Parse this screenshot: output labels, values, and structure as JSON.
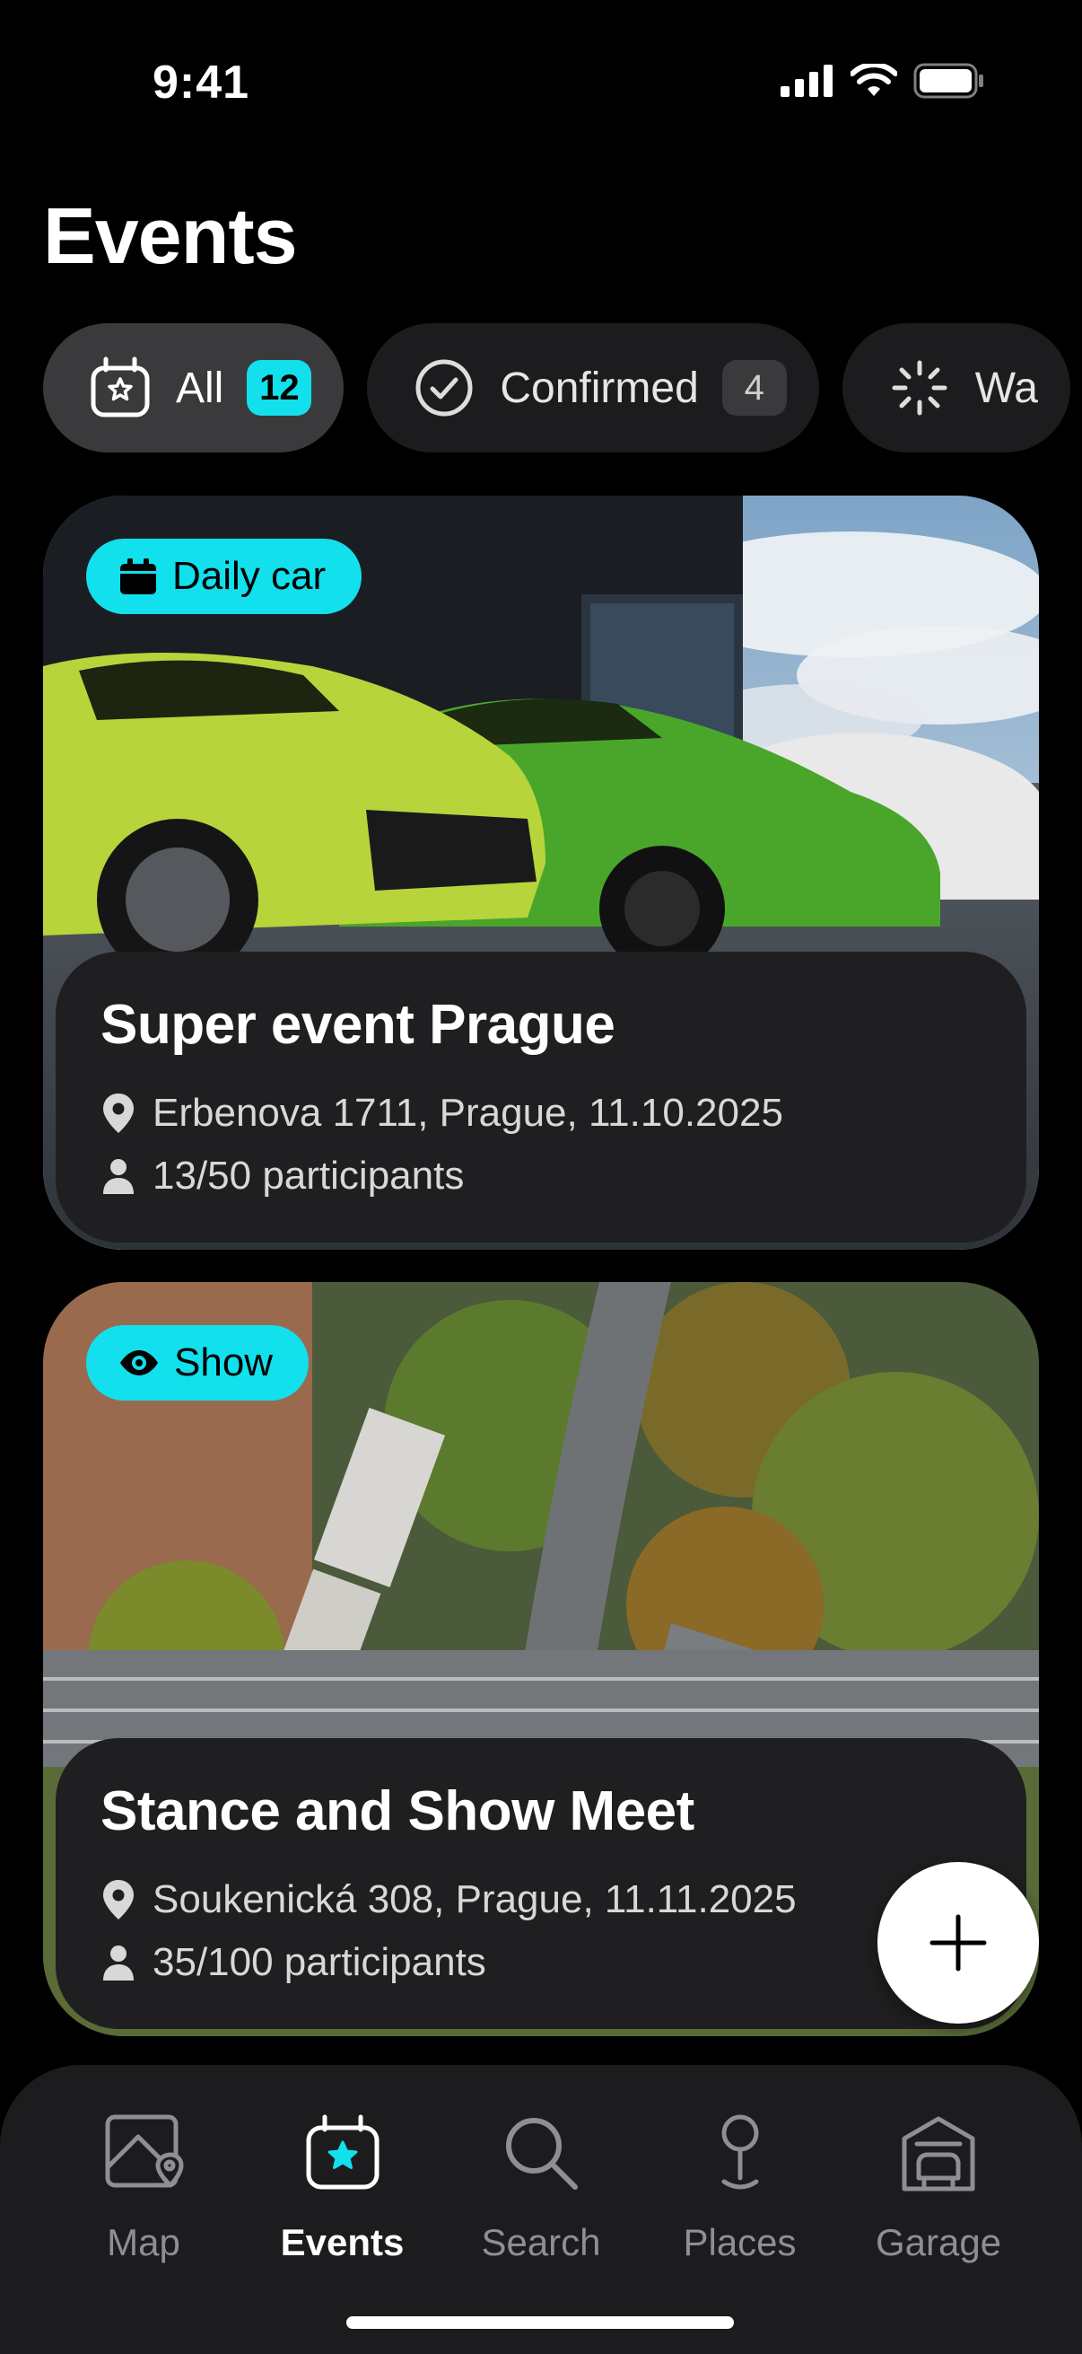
{
  "status_bar": {
    "time": "9:41"
  },
  "header": {
    "title": "Events"
  },
  "filters": [
    {
      "label": "All",
      "count": "12",
      "icon": "calendar-star-icon",
      "active": true
    },
    {
      "label": "Confirmed",
      "count": "4",
      "icon": "check-circle-icon",
      "active": false
    },
    {
      "label": "Wa",
      "icon": "loading-spinner-icon",
      "active": false
    }
  ],
  "events": [
    {
      "tag": "Daily car",
      "tag_icon": "calendar-icon",
      "title": "Super event Prague",
      "location": "Erbenova 1711, Prague, 11.10.2025",
      "participants": "13/50 participants",
      "image": "sports-cars-photo"
    },
    {
      "tag": "Show",
      "tag_icon": "eye-icon",
      "title": "Stance and Show Meet",
      "location": "Soukenická 308, Prague, 11.11.2025",
      "participants": "35/100 participants",
      "image": "highway-aerial-photo"
    }
  ],
  "fab": {
    "icon": "plus-icon"
  },
  "tab_bar": {
    "items": [
      {
        "label": "Map",
        "icon": "map-icon",
        "active": false
      },
      {
        "label": "Events",
        "icon": "calendar-star-icon",
        "active": true
      },
      {
        "label": "Search",
        "icon": "search-icon",
        "active": false
      },
      {
        "label": "Places",
        "icon": "pin-icon",
        "active": false
      },
      {
        "label": "Garage",
        "icon": "garage-icon",
        "active": false
      }
    ]
  },
  "colors": {
    "accent": "#12e0ec",
    "background": "#000000",
    "card": "#1f1f21"
  }
}
